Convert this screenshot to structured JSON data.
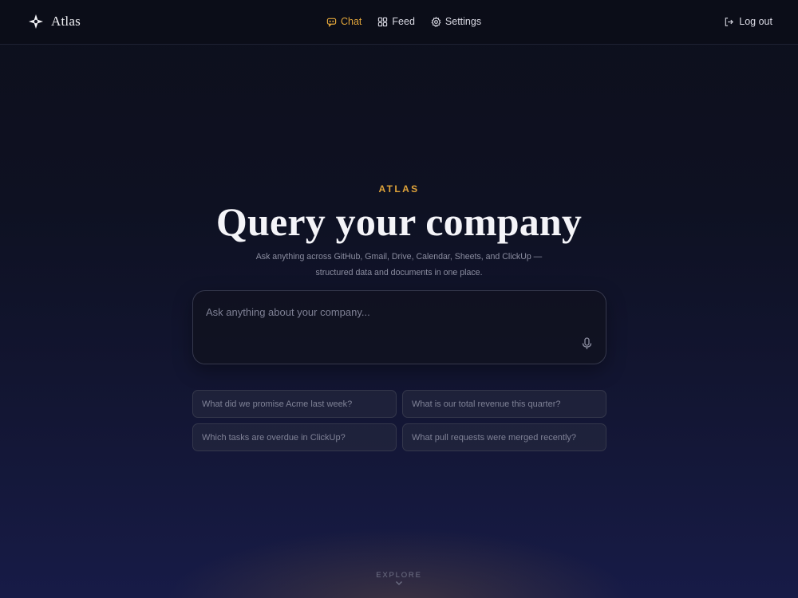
{
  "header": {
    "brand": "Atlas",
    "nav": [
      {
        "label": "Chat",
        "icon": "chat-icon",
        "active": true
      },
      {
        "label": "Feed",
        "icon": "grid-icon",
        "active": false
      },
      {
        "label": "Settings",
        "icon": "gear-icon",
        "active": false
      }
    ],
    "logout_label": "Log out"
  },
  "hero": {
    "eyebrow": "ATLAS",
    "title": "Query your company",
    "subtitle_line1": "Ask anything across GitHub, Gmail, Drive, Calendar, Sheets, and ClickUp —",
    "subtitle_line2": "structured data and documents in one place."
  },
  "query": {
    "placeholder": "Ask anything about your company...",
    "value": ""
  },
  "suggestions": [
    "What did we promise Acme last week?",
    "What is our total revenue this quarter?",
    "Which tasks are overdue in ClickUp?",
    "What pull requests were merged recently?"
  ],
  "explore_label": "EXPLORE",
  "colors": {
    "accent": "#e0a43a",
    "background_top": "#0d0f1c",
    "background_bottom": "#171b47",
    "text_primary": "#f4f4f8",
    "text_muted": "#8b8da0"
  }
}
